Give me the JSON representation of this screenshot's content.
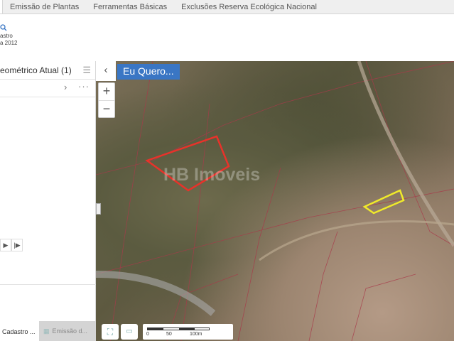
{
  "tabs": [
    "Emissão de Plantas",
    "Ferramentas Básicas",
    "Exclusões Reserva Ecológica Nacional"
  ],
  "ribbon": {
    "button_line1": "astro",
    "button_line2": "a 2012"
  },
  "panel": {
    "title": "eométrico Atual (1)"
  },
  "bottom_tabs": [
    "Cadastro ...",
    "Emissão d..."
  ],
  "map": {
    "eu_quero": "Eu Quero...",
    "watermark": "HB Imoveis",
    "scale_labels": [
      "0",
      "50",
      "100m"
    ],
    "zoom_in": "+",
    "zoom_out": "−",
    "highlight_colors": {
      "selected": "#e8322a",
      "other": "#f0ea2a"
    }
  }
}
